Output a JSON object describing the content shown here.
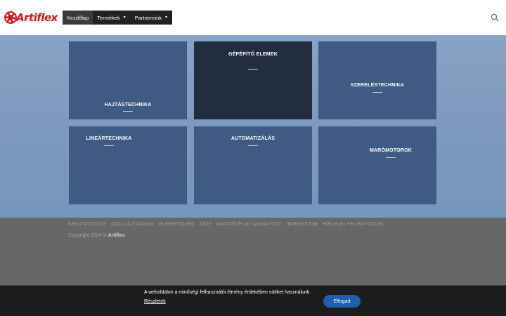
{
  "header": {
    "logo_text": "Artiflex",
    "nav": [
      {
        "label": "Kezdőlap"
      },
      {
        "label": "Termékek",
        "caret": "▼"
      },
      {
        "label": "Partnereink",
        "caret": "▼"
      }
    ]
  },
  "tiles": [
    {
      "title": "HAJTÁSTECHNIKA"
    },
    {
      "title": "GÉPÉPÍTŐ ELEMEK"
    },
    {
      "title": "SZERELÉSTECHNIKA"
    },
    {
      "title": "LINEÁRTECHNIKA"
    },
    {
      "title": "AUTOMATIZÁLÁS"
    },
    {
      "title": "MARÓMOTOROK"
    }
  ],
  "footer": {
    "links": [
      "BEMUTATKOZÁS",
      "SZOLGÁLTATÁSOK",
      "ELÉRHETŐSÉG",
      "ÁSZF",
      "ADATVÉDELMI SZABÁLYZAT",
      "IMPRESSZUM",
      "HÍRLEVÉL FELIRATKOZÁS"
    ],
    "copyright_prefix": "Copyright 2024 ©",
    "copyright_brand": "Artiflex"
  },
  "cookie": {
    "text": "A weboldalon a minőségi felhasználói élmény érdekében sütiket használunk.",
    "details_link": "Részletek",
    "accept_label": "Elfogad"
  },
  "colors": {
    "brand_red": "#d3181d",
    "tile_blue": "#3f5b84",
    "tile_dark": "#222d3f",
    "accept_blue": "#1f5fb2"
  }
}
